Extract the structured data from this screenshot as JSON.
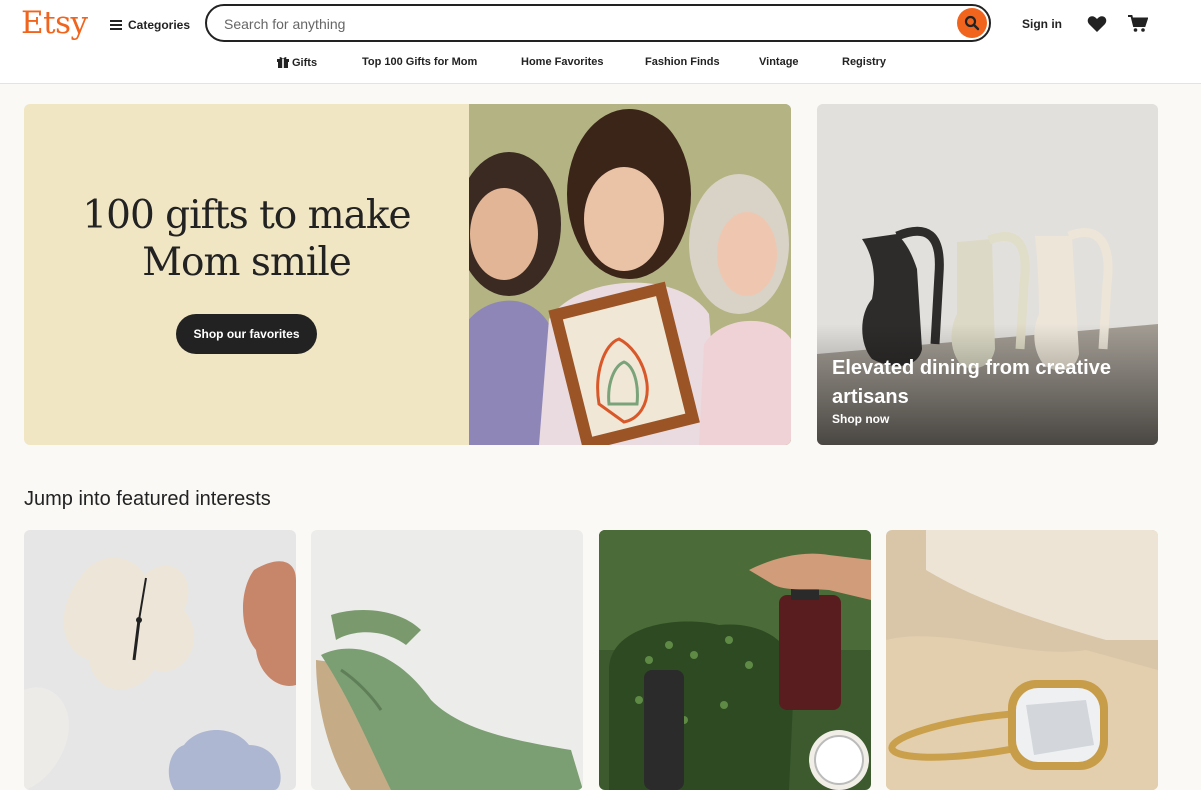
{
  "header": {
    "logo": "Etsy",
    "categories_label": "Categories",
    "search_placeholder": "Search for anything",
    "signin_label": "Sign in"
  },
  "nav": {
    "items": [
      {
        "label": "Gifts",
        "icon": "gift-icon"
      },
      {
        "label": "Top 100 Gifts for Mom"
      },
      {
        "label": "Home Favorites"
      },
      {
        "label": "Fashion Finds"
      },
      {
        "label": "Vintage"
      },
      {
        "label": "Registry"
      }
    ]
  },
  "hero": {
    "title_line1": "100 gifts to make",
    "title_line2": "Mom smile",
    "button_label": "Shop our favorites",
    "background_color": "#f1e6c4"
  },
  "promo": {
    "title": "Elevated dining from creative artisans",
    "link_label": "Shop now"
  },
  "interests": {
    "title": "Jump into featured interests",
    "cards": [
      "wall-clocks",
      "espadrille-wedges",
      "plants",
      "rings"
    ]
  },
  "colors": {
    "brand": "#f1641e",
    "text": "#222222",
    "page_bg": "#faf9f6"
  }
}
